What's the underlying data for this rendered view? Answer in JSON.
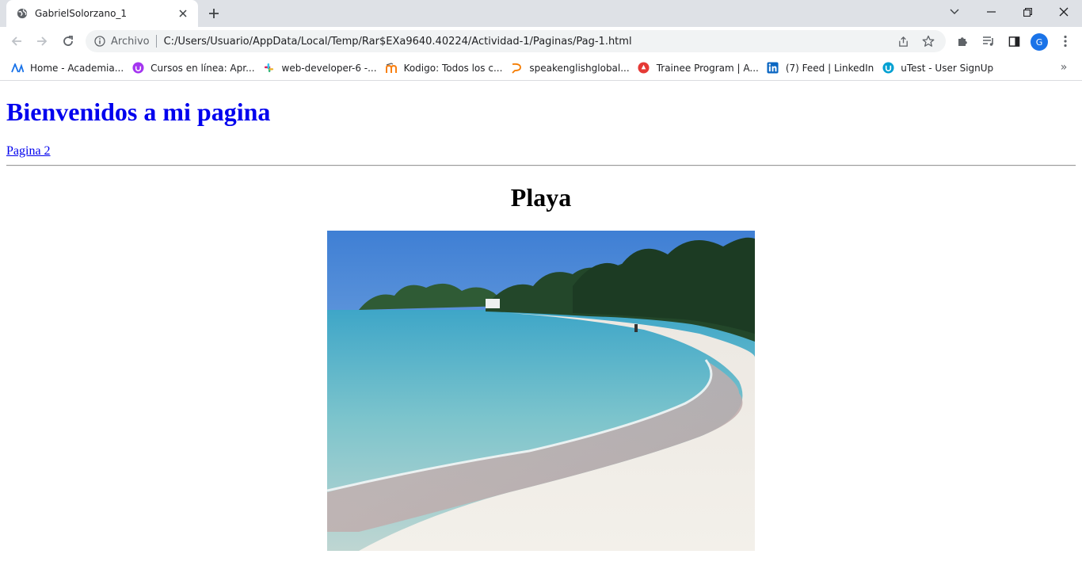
{
  "browser": {
    "tab": {
      "title": "GabrielSolorzano_1"
    },
    "omnibox": {
      "chip": "Archivo",
      "url": "C:/Users/Usuario/AppData/Local/Temp/Rar$EXa9640.40224/Actividad-1/Paginas/Pag-1.html"
    },
    "profile_initial": "G"
  },
  "bookmarks": [
    {
      "label": "Home - Academia...",
      "icon": "academia-icon",
      "color": "#1a73e8"
    },
    {
      "label": "Cursos en línea: Apr...",
      "icon": "udemy-icon",
      "color": "#a435f0"
    },
    {
      "label": "web-developer-6 -...",
      "icon": "slack-icon",
      "color": "#e01e5a"
    },
    {
      "label": "Kodigo: Todos los c...",
      "icon": "moodle-icon",
      "color": "#f98012"
    },
    {
      "label": "speakenglishglobal...",
      "icon": "speak-icon",
      "color": "#f57c00"
    },
    {
      "label": "Trainee Program | A...",
      "icon": "trainee-icon",
      "color": "#e53935"
    },
    {
      "label": "(7) Feed | LinkedIn",
      "icon": "linkedin-icon",
      "color": "#0a66c2"
    },
    {
      "label": "uTest - User SignUp",
      "icon": "utest-icon",
      "color": "#00a0d2"
    }
  ],
  "page": {
    "heading": "Bienvenidos a mi pagina",
    "link_label": "Pagina 2",
    "section_title": "Playa"
  }
}
